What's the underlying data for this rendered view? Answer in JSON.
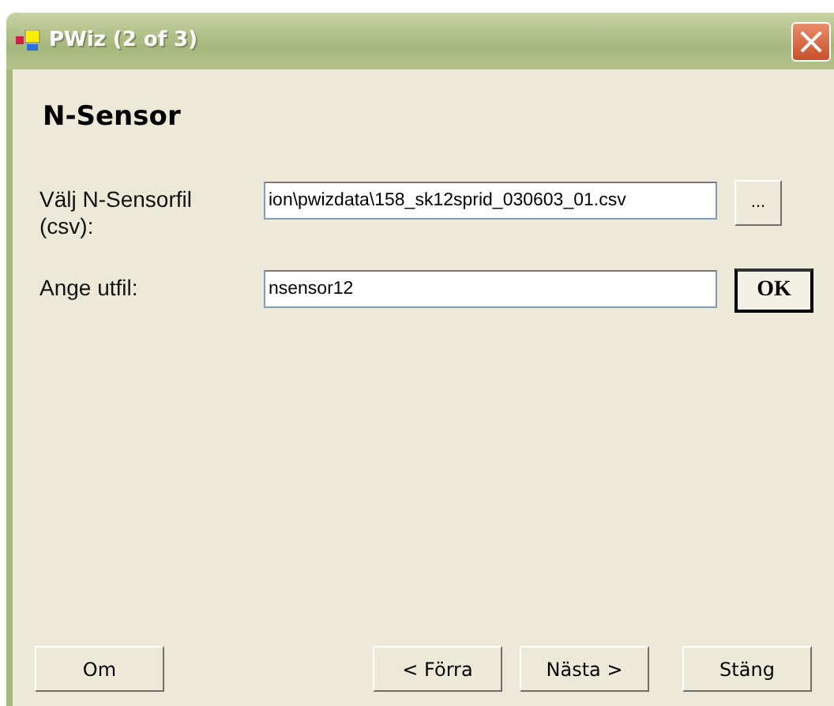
{
  "window": {
    "title": "PWiz (2 of 3)",
    "close": "×"
  },
  "heading": "N-Sensor",
  "fields": [
    {
      "label": "Välj N-Sensorfil (csv):",
      "value": "ion\\pwizdata\\158_sk12sprid_030603_01.csv",
      "button": "...",
      "bold_button": false
    },
    {
      "label": "Ange utfil:",
      "value": "nsensor12",
      "button": "OK",
      "bold_button": true
    }
  ],
  "left_buttons": [
    "Om"
  ],
  "right_buttons": [
    "< Förra",
    "Nästa >",
    "Stäng"
  ]
}
